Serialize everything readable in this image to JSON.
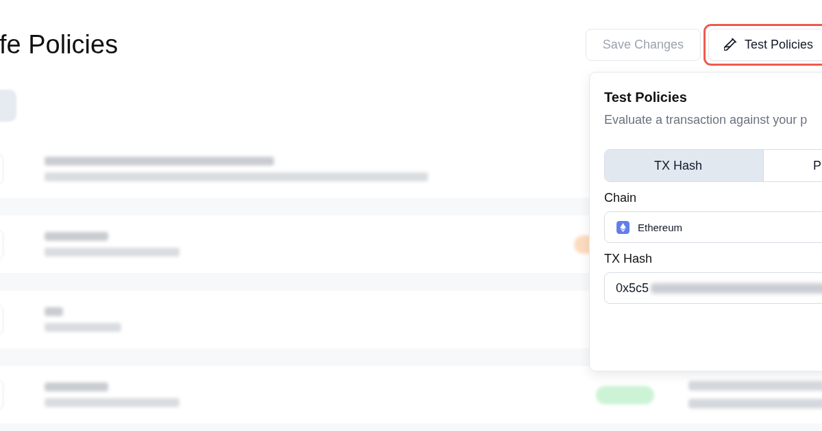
{
  "page_title": "fe Policies",
  "header_buttons": [
    {
      "kind": "text",
      "label": "Save Changes",
      "disabled": true,
      "highlighted": false
    },
    {
      "kind": "icon",
      "label": "Test Policies",
      "disabled": false,
      "highlighted": true
    }
  ],
  "policy_rows": [
    {
      "kind": "plain"
    },
    {
      "kind": "badge",
      "color": "#fcdcc0"
    },
    {
      "kind": "plain"
    },
    {
      "kind": "dated",
      "color": "#cdf3d6"
    }
  ],
  "test_panel": {
    "title": "Test Policies",
    "description": "Evaluate a transaction against your p",
    "tabs": [
      {
        "label": "TX Hash",
        "selected": true
      },
      {
        "label": "P",
        "selected": false
      }
    ],
    "chain": {
      "label": "Chain",
      "value": "Ethereum"
    },
    "tx_hash": {
      "label": "TX Hash",
      "value": "0x5c5"
    }
  }
}
